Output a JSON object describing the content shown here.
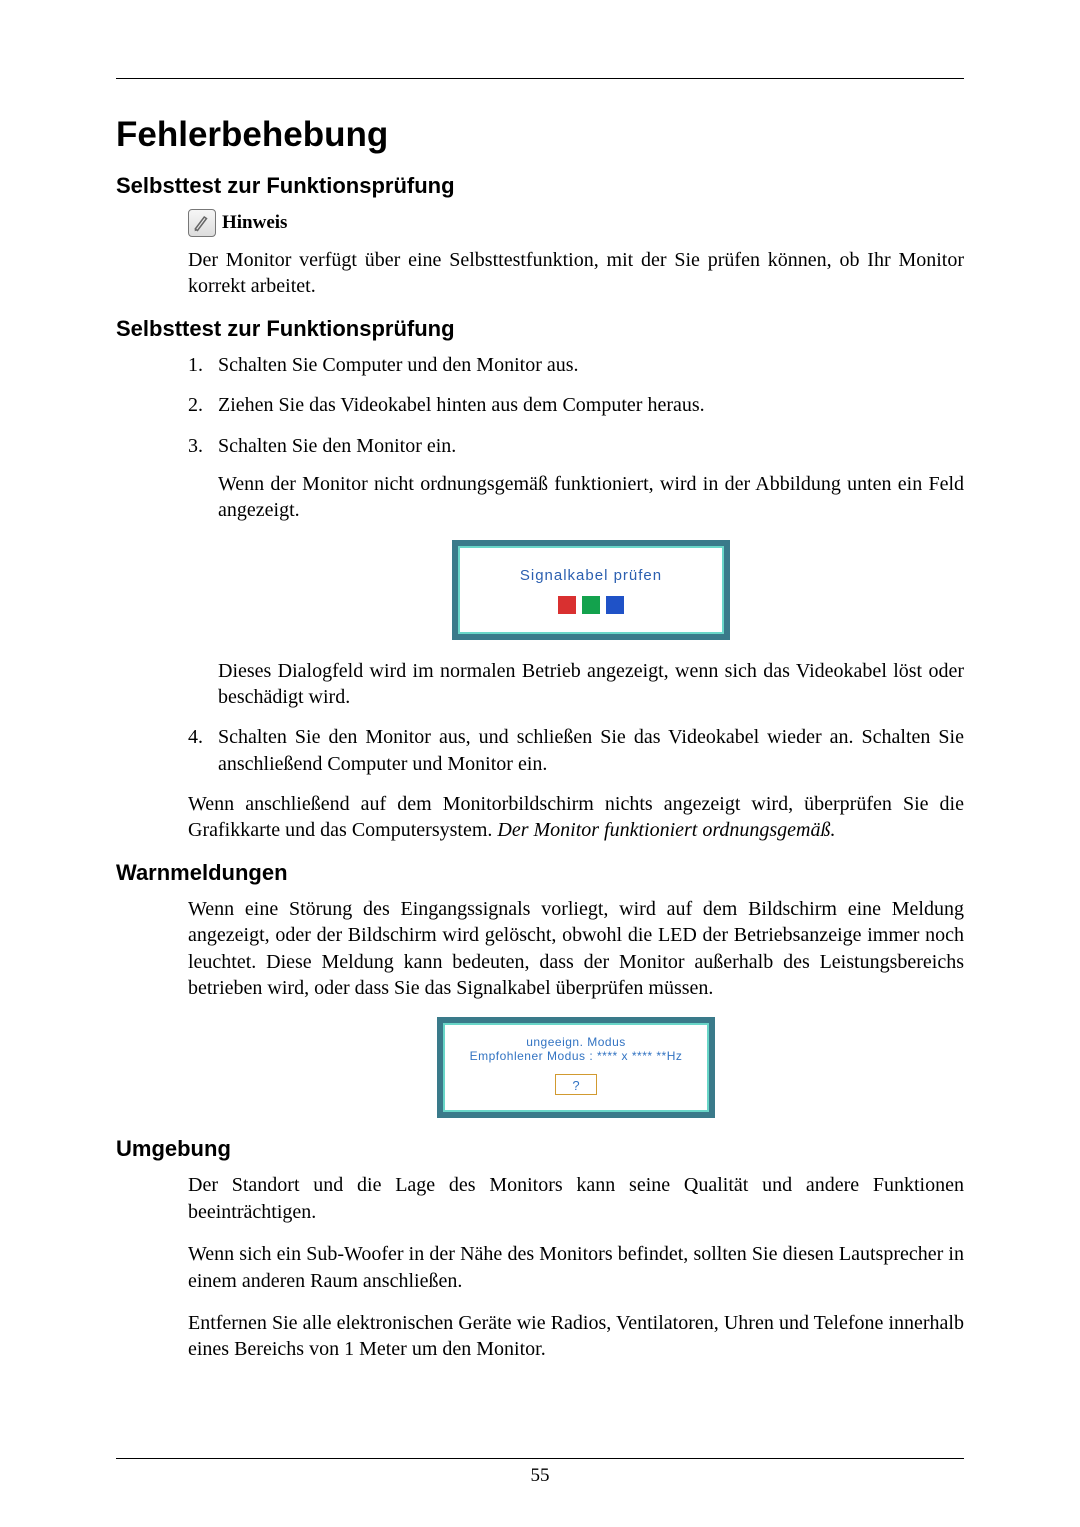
{
  "page_number": "55",
  "title": "Fehlerbehebung",
  "s1": {
    "heading": "Selbsttest zur Funktionsprüfung",
    "note_label": "Hinweis",
    "p1": "Der Monitor verfügt über eine Selbsttestfunktion, mit der Sie prüfen können, ob Ihr Monitor korrekt arbeitet."
  },
  "s2": {
    "heading": "Selbsttest zur Funktionsprüfung",
    "steps": {
      "i1": "Schalten Sie Computer und den Monitor aus.",
      "i2": "Ziehen Sie das Videokabel hinten aus dem Computer heraus.",
      "i3": "Schalten Sie den Monitor ein.",
      "i3_p1": "Wenn der Monitor nicht ordnungsgemäß funktioniert, wird in der Abbildung unten ein Feld angezeigt.",
      "i3_fig_text": "Signalkabel prüfen",
      "i3_p2": "Dieses Dialogfeld wird im normalen Betrieb angezeigt, wenn sich das Videokabel löst oder beschädigt wird.",
      "i4": "Schalten Sie den Monitor aus, und schließen Sie das Videokabel wieder an. Schalten Sie anschließend Computer und Monitor ein."
    },
    "after_p_main": "Wenn anschließend auf dem Monitorbildschirm nichts angezeigt wird, überprüfen Sie die Grafikkarte und das Computersystem. ",
    "after_p_italic": "Der Monitor funktioniert ordnungsgemäß."
  },
  "s3": {
    "heading": "Warnmeldungen",
    "p1": "Wenn eine Störung des Eingangssignals vorliegt, wird auf dem Bildschirm eine Meldung angezeigt, oder der Bildschirm wird gelöscht, obwohl die LED der Betriebsanzeige immer noch leuchtet. Diese Meldung kann bedeuten, dass der Monitor außerhalb des Leistungsbereichs betrieben wird, oder dass Sie das Signalkabel überprüfen müssen.",
    "fig_l1": "ungeeign. Modus",
    "fig_l2": "Empfohlener Modus :  **** x ****  **Hz",
    "fig_btn": "?"
  },
  "s4": {
    "heading": "Umgebung",
    "p1": "Der Standort und die Lage des Monitors kann seine Qualität und andere Funktionen beeinträchtigen.",
    "p2": "Wenn sich ein Sub-Woofer in der Nähe des Monitors befindet, sollten Sie diesen Lautsprecher in einem anderen Raum anschließen.",
    "p3": "Entfernen Sie alle elektronischen Geräte wie Radios, Ventilatoren, Uhren und Telefone innerhalb eines Bereichs von 1 Meter um den Monitor."
  }
}
